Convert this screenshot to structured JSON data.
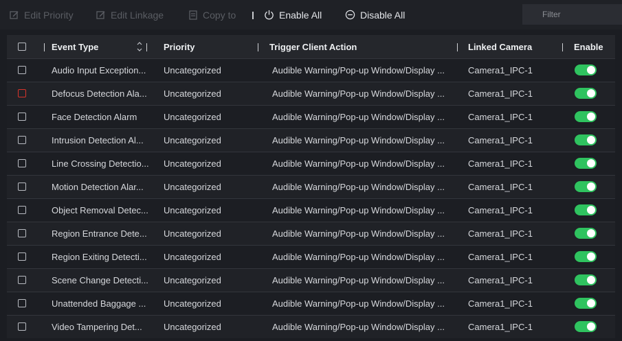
{
  "toolbar": {
    "edit_priority": "Edit Priority",
    "edit_linkage": "Edit Linkage",
    "copy_to": "Copy to",
    "enable_all": "Enable All",
    "disable_all": "Disable All",
    "filter_placeholder": "Filter"
  },
  "columns": {
    "event_type": "Event Type",
    "priority": "Priority",
    "trigger_client_action": "Trigger Client Action",
    "linked_camera": "Linked Camera",
    "enable": "Enable"
  },
  "rows": [
    {
      "event_type": "Audio Input Exception...",
      "priority": "Uncategorized",
      "action": "Audible Warning/Pop-up Window/Display ...",
      "camera": "Camera1_IPC-1",
      "enabled": true
    },
    {
      "event_type": "Defocus Detection Ala...",
      "priority": "Uncategorized",
      "action": "Audible Warning/Pop-up Window/Display ...",
      "camera": "Camera1_IPC-1",
      "enabled": true
    },
    {
      "event_type": "Face Detection Alarm",
      "priority": "Uncategorized",
      "action": "Audible Warning/Pop-up Window/Display ...",
      "camera": "Camera1_IPC-1",
      "enabled": true
    },
    {
      "event_type": "Intrusion Detection Al...",
      "priority": "Uncategorized",
      "action": "Audible Warning/Pop-up Window/Display ...",
      "camera": "Camera1_IPC-1",
      "enabled": true
    },
    {
      "event_type": "Line Crossing Detectio...",
      "priority": "Uncategorized",
      "action": "Audible Warning/Pop-up Window/Display ...",
      "camera": "Camera1_IPC-1",
      "enabled": true
    },
    {
      "event_type": "Motion Detection Alar...",
      "priority": "Uncategorized",
      "action": "Audible Warning/Pop-up Window/Display ...",
      "camera": "Camera1_IPC-1",
      "enabled": true
    },
    {
      "event_type": "Object Removal Detec...",
      "priority": "Uncategorized",
      "action": "Audible Warning/Pop-up Window/Display ...",
      "camera": "Camera1_IPC-1",
      "enabled": true
    },
    {
      "event_type": "Region Entrance Dete...",
      "priority": "Uncategorized",
      "action": "Audible Warning/Pop-up Window/Display ...",
      "camera": "Camera1_IPC-1",
      "enabled": true
    },
    {
      "event_type": "Region Exiting Detecti...",
      "priority": "Uncategorized",
      "action": "Audible Warning/Pop-up Window/Display ...",
      "camera": "Camera1_IPC-1",
      "enabled": true
    },
    {
      "event_type": "Scene Change Detecti...",
      "priority": "Uncategorized",
      "action": "Audible Warning/Pop-up Window/Display ...",
      "camera": "Camera1_IPC-1",
      "enabled": true
    },
    {
      "event_type": "Unattended Baggage ...",
      "priority": "Uncategorized",
      "action": "Audible Warning/Pop-up Window/Display ...",
      "camera": "Camera1_IPC-1",
      "enabled": true
    },
    {
      "event_type": "Video Tampering Det...",
      "priority": "Uncategorized",
      "action": "Audible Warning/Pop-up Window/Display ...",
      "camera": "Camera1_IPC-1",
      "enabled": true
    }
  ],
  "colors": {
    "accent_green": "#2fc35f",
    "checkbox_alert": "#d9342b",
    "background": "#1b1d22"
  }
}
